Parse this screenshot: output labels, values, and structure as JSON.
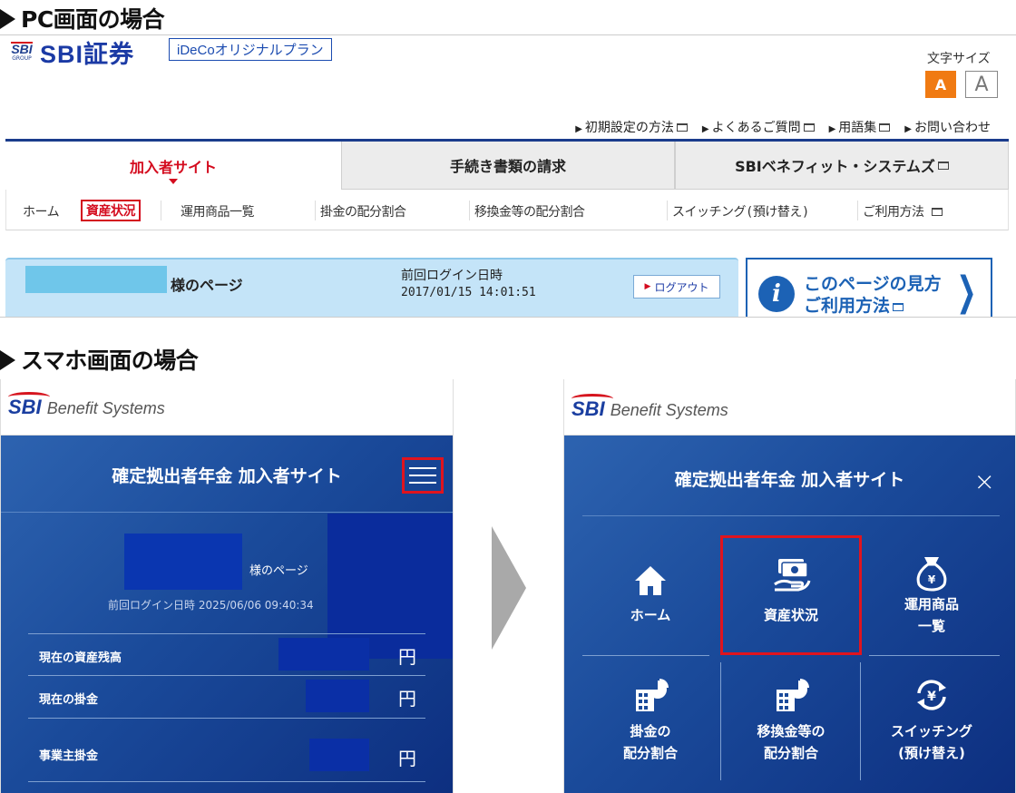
{
  "sections": {
    "pc_title": "PC画面の場合",
    "sp_title": "スマホ画面の場合"
  },
  "pc": {
    "logo_badge": "SBI",
    "logo_group": "GROUP",
    "brand": "SBI証券",
    "plan_label": "iDeCoオリジナルプラン",
    "font_size_label": "文字サイズ",
    "font_small": "A",
    "font_large": "A",
    "top_links": [
      "初期設定の方法",
      "よくあるご質問",
      "用語集",
      "お問い合わせ"
    ],
    "tabs": [
      "加入者サイト",
      "手続き書類の請求",
      "SBIベネフィット・システムズ"
    ],
    "subnav": [
      "ホーム",
      "資産状況",
      "運用商品一覧",
      "掛金の配分割合",
      "移換金等の配分割合",
      "スイッチング(預け替え)",
      "ご利用方法"
    ],
    "user_suffix": "様のページ",
    "last_login_label": "前回ログイン日時",
    "last_login_value": "2017/01/15 14:01:51",
    "logout_label": "ログアウト",
    "help_line1": "このページの見方",
    "help_line2": "ご利用方法"
  },
  "sp1": {
    "logo_sbi": "SBI",
    "logo_text": "Benefit Systems",
    "title": "確定拠出者年金 加入者サイト",
    "user_suffix": "様のページ",
    "last_login": "前回ログイン日時 2025/06/06 09:40:34",
    "rows": [
      {
        "label": "現在の資産残高",
        "unit": "円"
      },
      {
        "label": "現在の掛金",
        "unit": "円"
      },
      {
        "label": "事業主掛金",
        "unit": "円"
      }
    ]
  },
  "sp2": {
    "logo_sbi": "SBI",
    "logo_text": "Benefit Systems",
    "title": "確定拠出者年金 加入者サイト",
    "close": "×",
    "menu": [
      {
        "label1": "ホーム",
        "label2": ""
      },
      {
        "label1": "資産状況",
        "label2": ""
      },
      {
        "label1": "運用商品",
        "label2": "一覧"
      },
      {
        "label1": "掛金の",
        "label2": "配分割合"
      },
      {
        "label1": "移換金等の",
        "label2": "配分割合"
      },
      {
        "label1": "スイッチング",
        "label2": "(預け替え)"
      }
    ]
  },
  "colors": {
    "brand_blue": "#1b3aa5",
    "highlight_red": "#e0141e",
    "accent_orange": "#f07a12"
  }
}
